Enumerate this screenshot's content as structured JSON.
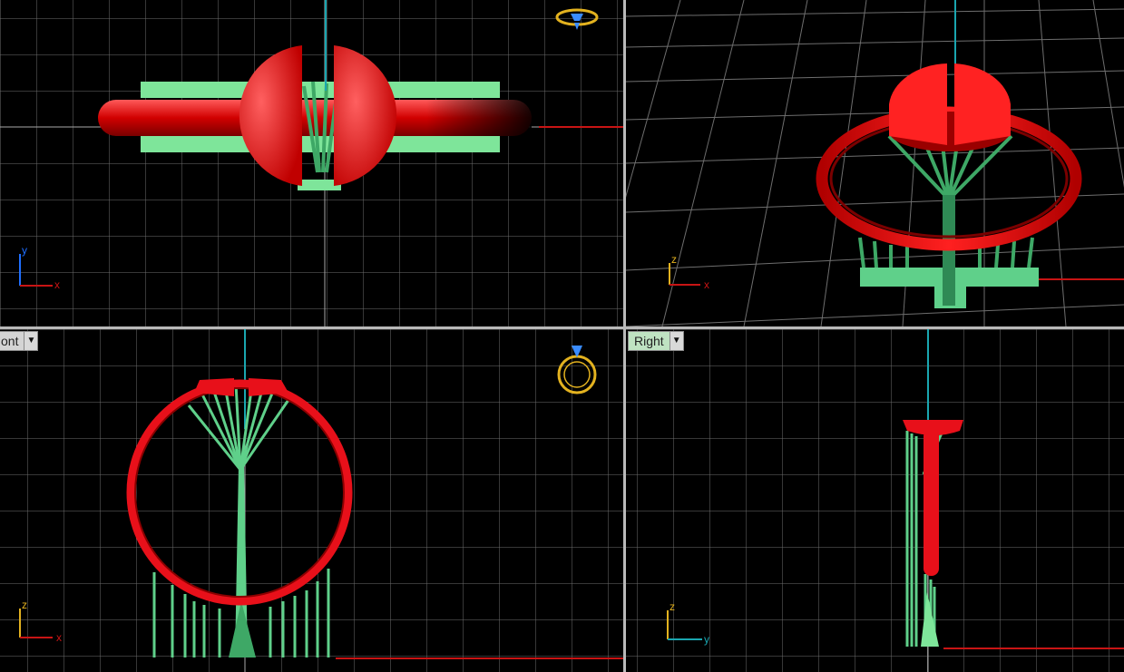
{
  "viewports": {
    "top": {
      "tab_label": "",
      "axes": [
        "y",
        "x"
      ]
    },
    "perspective": {
      "tab_label": "",
      "axes": [
        "z",
        "x"
      ]
    },
    "front": {
      "tab_label": "ont",
      "axes": [
        "z",
        "x"
      ]
    },
    "right": {
      "tab_label": "Right",
      "axes": [
        "z",
        "y"
      ]
    }
  },
  "icons": {
    "tab_dropdown": "chevron-down-icon",
    "ring_top": "ring-top-view-icon",
    "ring_front": "ring-front-view-icon"
  },
  "colors": {
    "background": "#000000",
    "grid": "#6e6e6e",
    "grid_major": "#a9a9a9",
    "ring": "#e8101a",
    "supports": "#5fd08a",
    "base": "#7ee59a",
    "z_axis": "#1aa6b0",
    "x_axis": "#c81414",
    "widget": "#e3b21f"
  }
}
